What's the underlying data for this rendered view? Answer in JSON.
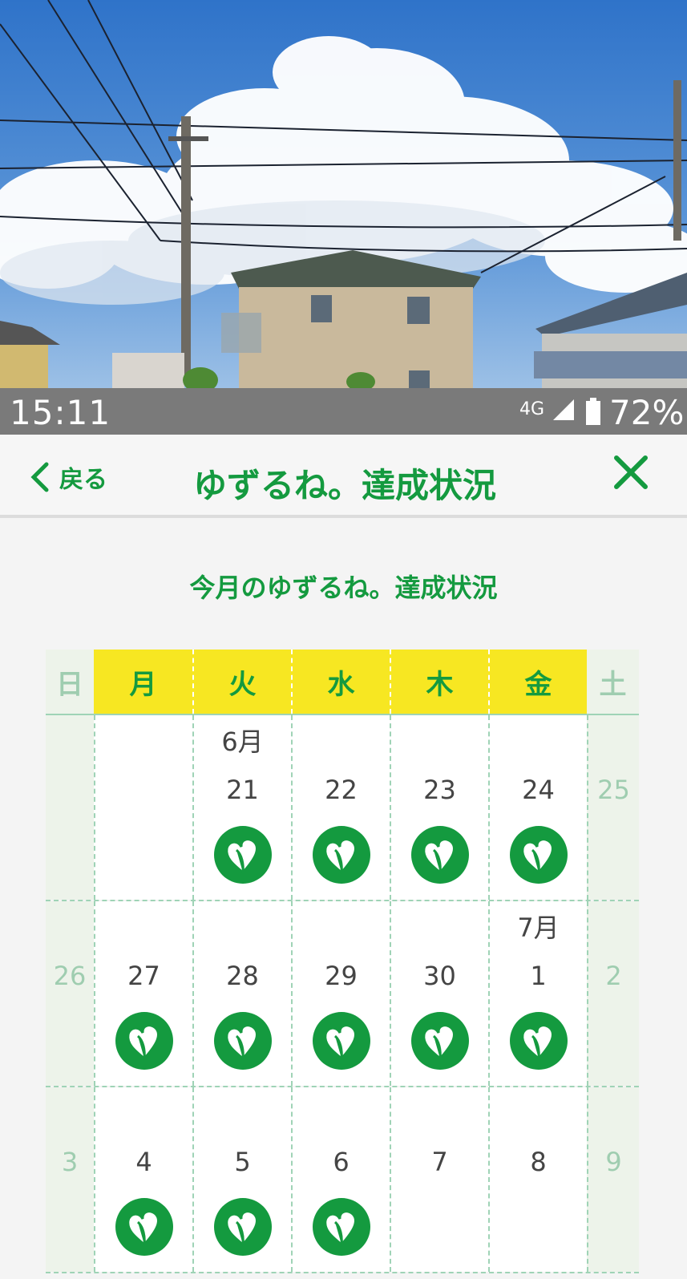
{
  "status_bar": {
    "time": "15:11",
    "network": "4G",
    "battery": "72%"
  },
  "header": {
    "back_label": "戻る",
    "title": "ゆずるね。達成状況"
  },
  "section_title": "今月のゆずるね。達成状況",
  "colors": {
    "accent": "#149a3f",
    "weekday_header": "#f7e722",
    "weekend_bg": "#edf3ea",
    "weekend_text": "#9fcdb0"
  },
  "calendar": {
    "weekdays": [
      "日",
      "月",
      "火",
      "水",
      "木",
      "金",
      "土"
    ],
    "weeks": [
      [
        {
          "day": "",
          "month": "",
          "achieved": false
        },
        {
          "day": "",
          "month": "",
          "achieved": false
        },
        {
          "day": "21",
          "month": "6月",
          "achieved": true
        },
        {
          "day": "22",
          "month": "",
          "achieved": true
        },
        {
          "day": "23",
          "month": "",
          "achieved": true
        },
        {
          "day": "24",
          "month": "",
          "achieved": true
        },
        {
          "day": "25",
          "month": "",
          "achieved": false
        }
      ],
      [
        {
          "day": "26",
          "month": "",
          "achieved": false
        },
        {
          "day": "27",
          "month": "",
          "achieved": true
        },
        {
          "day": "28",
          "month": "",
          "achieved": true
        },
        {
          "day": "29",
          "month": "",
          "achieved": true
        },
        {
          "day": "30",
          "month": "",
          "achieved": true
        },
        {
          "day": "1",
          "month": "7月",
          "achieved": true
        },
        {
          "day": "2",
          "month": "",
          "achieved": false
        }
      ],
      [
        {
          "day": "3",
          "month": "",
          "achieved": false
        },
        {
          "day": "4",
          "month": "",
          "achieved": true
        },
        {
          "day": "5",
          "month": "",
          "achieved": true
        },
        {
          "day": "6",
          "month": "",
          "achieved": true
        },
        {
          "day": "7",
          "month": "",
          "achieved": false
        },
        {
          "day": "8",
          "month": "",
          "achieved": false
        },
        {
          "day": "9",
          "month": "",
          "achieved": false
        }
      ]
    ],
    "achievement_icon": "heart-leaf-badge-icon"
  }
}
